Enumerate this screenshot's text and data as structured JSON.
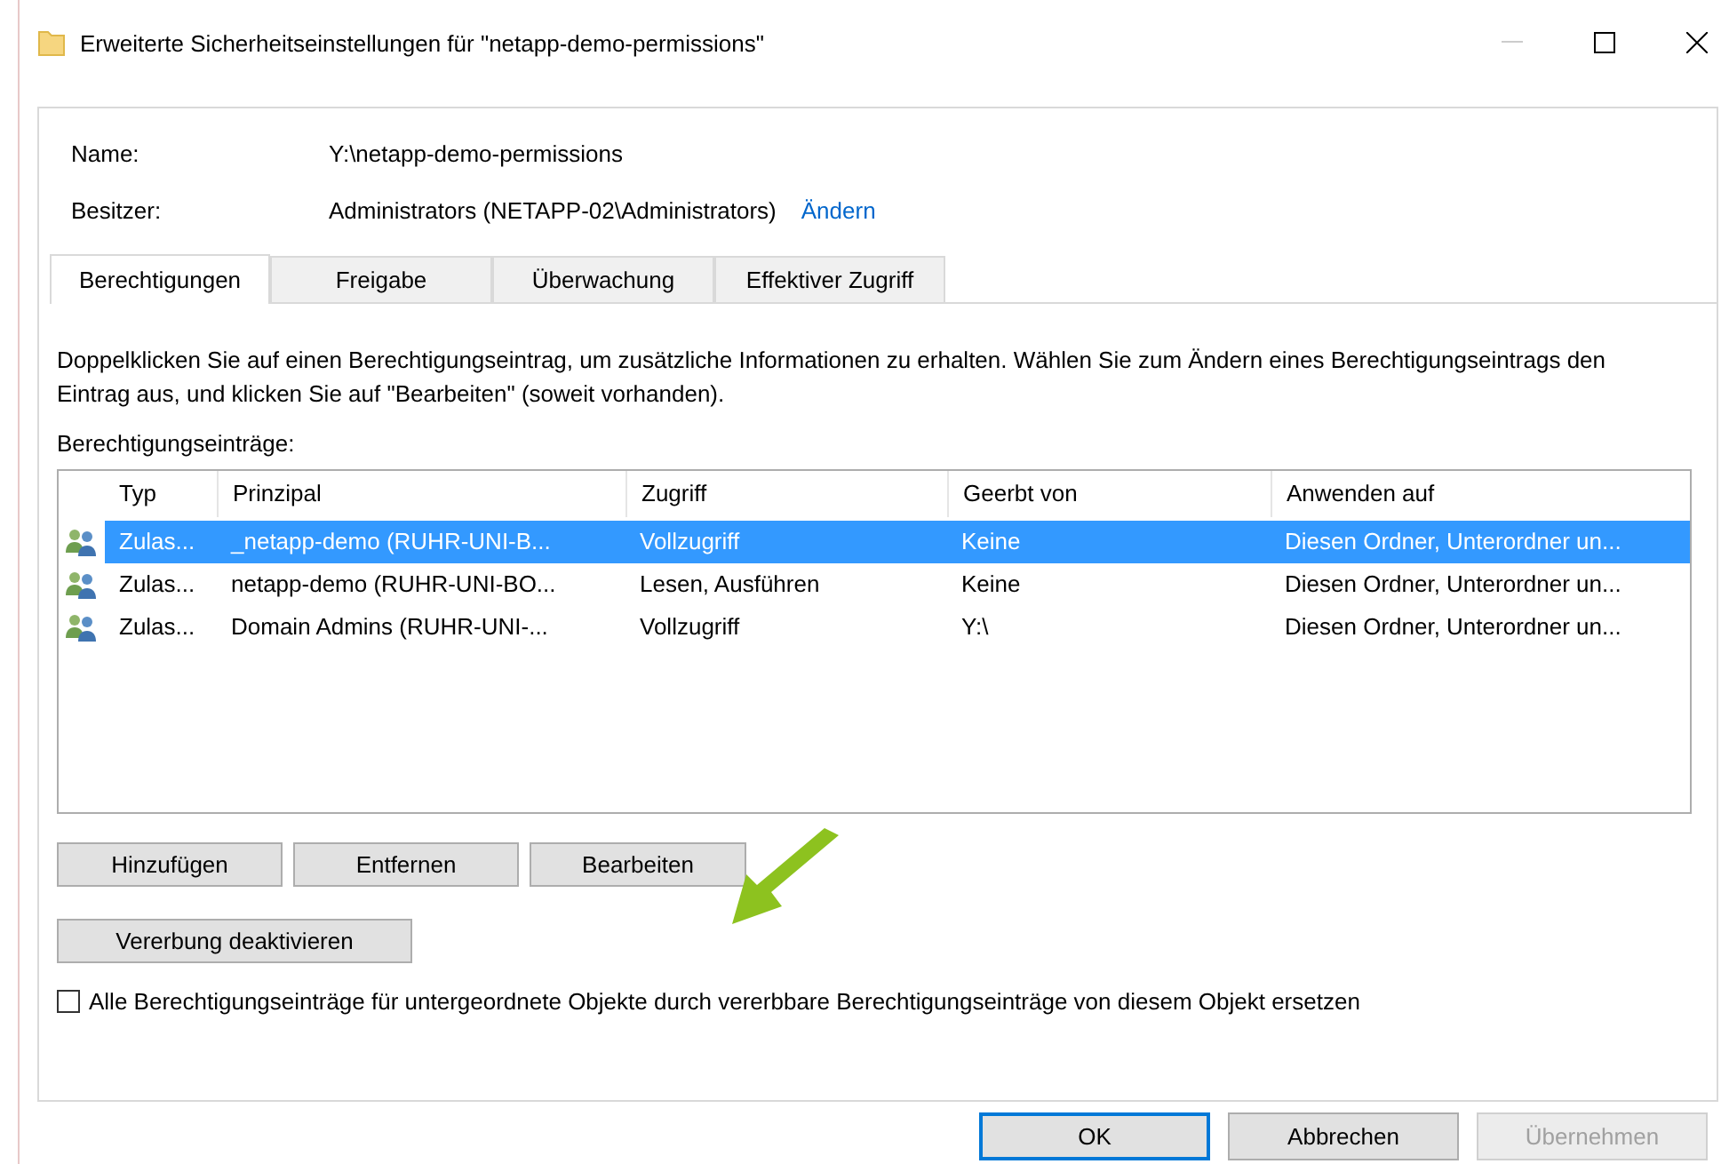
{
  "window": {
    "title": "Erweiterte Sicherheitseinstellungen für \"netapp-demo-permissions\""
  },
  "fields": [
    {
      "label": "Name:",
      "value": "Y:\\netapp-demo-permissions"
    },
    {
      "label": "Besitzer:",
      "value": "Administrators (NETAPP-02\\Administrators)",
      "link": "Ändern"
    }
  ],
  "tabs": [
    {
      "label": "Berechtigungen",
      "selected": true
    },
    {
      "label": "Freigabe",
      "selected": false
    },
    {
      "label": "Überwachung",
      "selected": false
    },
    {
      "label": "Effektiver Zugriff",
      "selected": false
    }
  ],
  "info": "Doppelklicken Sie auf einen Berechtigungseintrag, um zusätzliche Informationen zu erhalten. Wählen Sie zum Ändern eines Berechtigungseintrags den Eintrag aus, und klicken Sie auf \"Bearbeiten\" (soweit vorhanden).",
  "list_label": "Berechtigungseinträge:",
  "table": {
    "columns": [
      "Typ",
      "Prinzipal",
      "Zugriff",
      "Geerbt von",
      "Anwenden auf"
    ],
    "rows": [
      {
        "selected": true,
        "cells": [
          "Zulas...",
          "_netapp-demo (RUHR-UNI-B...",
          "Vollzugriff",
          "Keine",
          "Diesen Ordner, Unterordner un..."
        ]
      },
      {
        "selected": false,
        "cells": [
          "Zulas...",
          "netapp-demo (RUHR-UNI-BO...",
          "Lesen, Ausführen",
          "Keine",
          "Diesen Ordner, Unterordner un..."
        ]
      },
      {
        "selected": false,
        "cells": [
          "Zulas...",
          "Domain Admins (RUHR-UNI-...",
          "Vollzugriff",
          "Y:\\",
          "Diesen Ordner, Unterordner un..."
        ]
      }
    ]
  },
  "entry_buttons": [
    "Hinzufügen",
    "Entfernen",
    "Bearbeiten"
  ],
  "inherit_button": "Vererbung deaktivieren",
  "replace_checkbox": {
    "label": "Alle Berechtigungseinträge für untergeordnete Objekte durch vererbbare Berechtigungseinträge von diesem Objekt ersetzen",
    "checked": false
  },
  "dialog_buttons": [
    {
      "label": "OK",
      "default": true,
      "disabled": false
    },
    {
      "label": "Abbrechen",
      "default": false,
      "disabled": false
    },
    {
      "label": "Übernehmen",
      "default": false,
      "disabled": true
    }
  ]
}
